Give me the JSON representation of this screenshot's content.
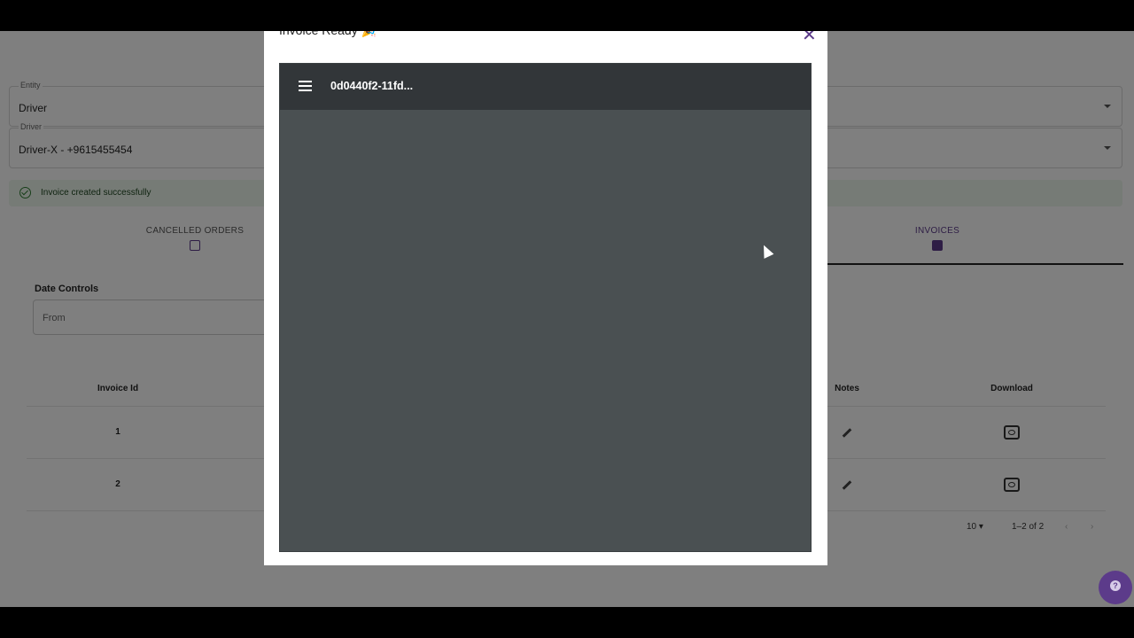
{
  "form": {
    "entity": {
      "label": "Entity",
      "value": "Driver"
    },
    "driver": {
      "label": "Driver",
      "value": "Driver-X - +9615455454"
    }
  },
  "alert": {
    "text": "Invoice created successfully"
  },
  "tabs": [
    {
      "label": "CANCELLED ORDERS",
      "icon": "calendar-x-icon"
    },
    {
      "label": "INVOICES",
      "icon": "document-icon"
    }
  ],
  "date_controls": {
    "title": "Date Controls",
    "from_placeholder": "From"
  },
  "table": {
    "headers": {
      "invoice_id": "Invoice Id",
      "notes": "Notes",
      "download": "Download"
    },
    "rows": [
      {
        "invoice_id": "1"
      },
      {
        "invoice_id": "2"
      }
    ]
  },
  "pagination": {
    "rows_per_page": "10",
    "range": "1–2 of 2"
  },
  "modal": {
    "title": "Invoice Ready 🎉",
    "viewer_filename": "0d0440f2-11fd..."
  },
  "colors": {
    "accent": "#5c3b8a",
    "success_bg": "#edf7ed",
    "viewer_bg": "#4a5052",
    "viewer_bar": "#323639"
  }
}
